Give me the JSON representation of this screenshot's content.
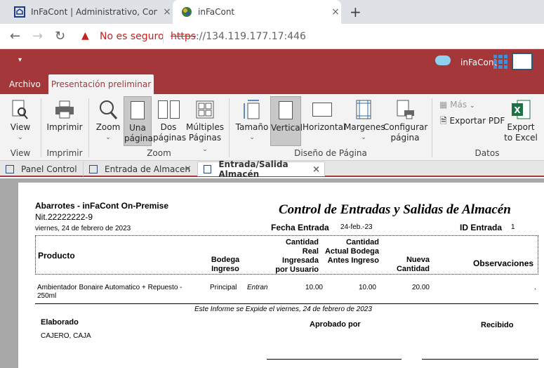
{
  "browser": {
    "tabs": [
      {
        "title": "InFaCont | Administrativo, Contat",
        "active": false
      },
      {
        "title": "inFaCont",
        "active": true
      }
    ],
    "new_tab": "+",
    "close_glyph": "×",
    "security_label": "No es seguro",
    "url_scheme": "https",
    "url_rest": "://134.119.177.17:446"
  },
  "app": {
    "brand": "inFaCont",
    "quick_access": "▾",
    "ribbon_tabs": [
      "Archivo",
      "Presentación preliminar"
    ]
  },
  "ribbon": {
    "view": {
      "label": "View",
      "group": "View"
    },
    "print": {
      "label": "Imprimir",
      "group": "Imprimir"
    },
    "zoom": {
      "label": "Zoom",
      "one_page_1": "Una",
      "one_page_2": "página",
      "two_pages_1": "Dos",
      "two_pages_2": "páginas",
      "multi_1": "Múltiples",
      "multi_2": "Páginas",
      "group": "Zoom"
    },
    "page": {
      "size": "Tamaño",
      "vertical": "Vertical",
      "horizontal": "Horizontal",
      "margins": "Margenes",
      "config_1": "Configurar",
      "config_2": "página",
      "group": "Diseño de Página"
    },
    "data": {
      "more": "Más",
      "export_pdf": "Exportar PDF",
      "export_excel_1": "Export",
      "export_excel_2": "to Excel",
      "group": "Datos"
    }
  },
  "doc_tabs": [
    "Panel Control",
    "Entrada de Almacen",
    "Entrada/Salida Almacén"
  ],
  "report": {
    "company": "Abarrotes - inFaCont On-Premise",
    "nit": "Nit.22222222-9",
    "date_long": "viernes, 24 de febrero de 2023",
    "title": "Control de Entradas y Salidas de Almacén",
    "fecha_label": "Fecha Entrada",
    "fecha_value": "24-feb.-23",
    "id_label": "ID Entrada",
    "id_value": "1",
    "columns": {
      "producto": "Producto",
      "bodega_1": "Bodega",
      "bodega_2": "Ingreso",
      "cant_1": "Cantidad",
      "cant_2": "Real",
      "cant_3": "Ingresada",
      "cant_4": "por Usuario",
      "actual_1": "Cantidad",
      "actual_2": "Actual Bodega",
      "actual_3": "Antes Ingreso",
      "nueva_1": "Nueva",
      "nueva_2": "Cantidad",
      "obs": "Observaciones"
    },
    "rows": [
      {
        "producto_1": "Ambientador Bonaire Automatico + Repuesto -",
        "producto_2": "250ml",
        "bodega": "Principal",
        "tipo": "Entran",
        "cantidad": "10.00",
        "actual": "10.00",
        "nueva": "20.00",
        "obs": "."
      }
    ],
    "footer_note": "Este Informe se Expide el viernes, 24 de febrero de 2023",
    "elaborado_label": "Elaborado",
    "elaborado_value": "CAJERO, CAJA",
    "aprobado_label": "Aprobado por",
    "recibido_label": "Recibido"
  },
  "colors": {
    "accent": "#a4373a",
    "ribbon_bg": "#f3f3f3",
    "report_bg": "#a8a8a8"
  }
}
